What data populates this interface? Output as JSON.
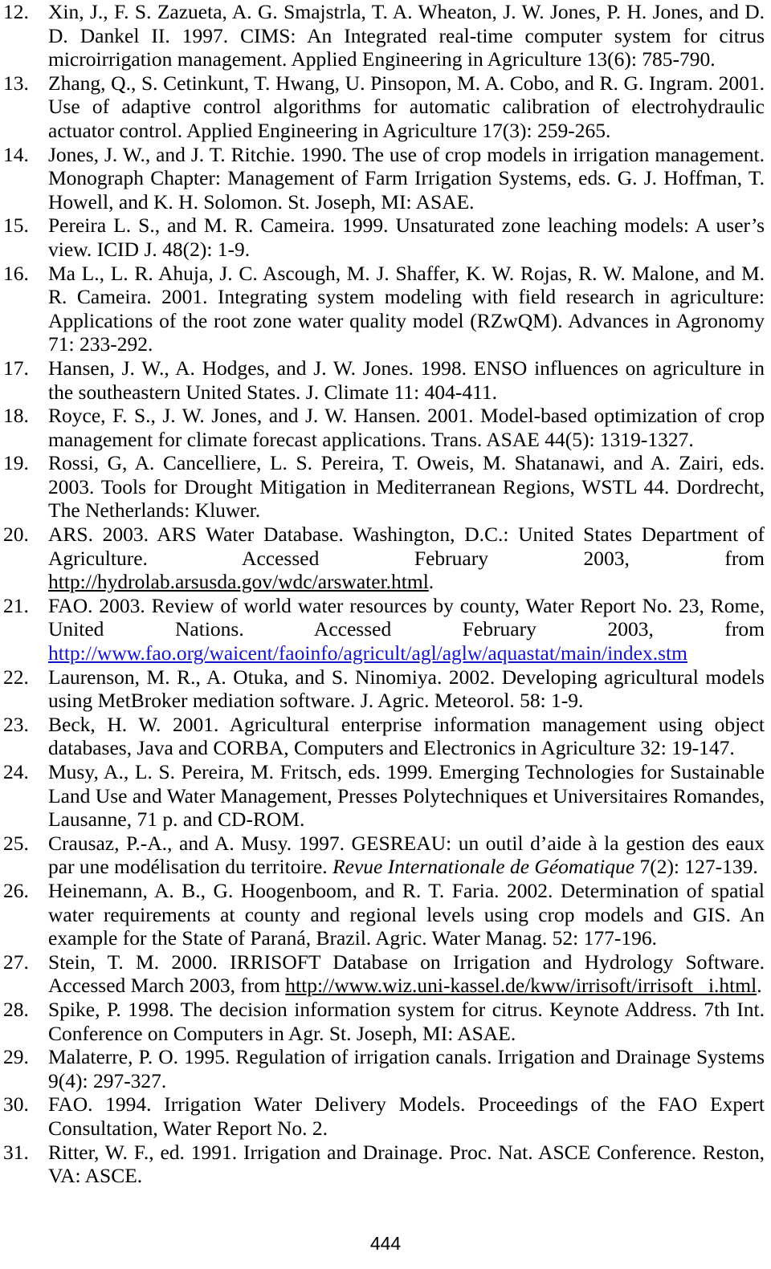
{
  "document": {
    "type": "references-page",
    "page_number": "444",
    "link_color": "#1414c8",
    "text_color": "#000000",
    "background_color": "#ffffff"
  },
  "references": [
    {
      "number": "12.",
      "text": "Xin, J., F. S. Zazueta, A. G. Smajstrla, T. A. Wheaton, J. W. Jones, P. H. Jones, and D. D. Dankel II. 1997. CIMS: An Integrated real-time computer system for citrus microirrigation management. Applied Engineering in Agriculture 13(6): 785-790."
    },
    {
      "number": "13.",
      "text": "Zhang, Q., S. Cetinkunt, T. Hwang, U. Pinsopon, M. A. Cobo, and R. G. Ingram. 2001. Use of adaptive control algorithms for automatic calibration of electrohydraulic actuator control. Applied Engineering in Agriculture 17(3): 259-265."
    },
    {
      "number": "14.",
      "text": "Jones, J. W., and J. T. Ritchie. 1990. The use of crop models in irrigation management. Monograph Chapter: Management of Farm Irrigation Systems, eds. G. J. Hoffman, T. Howell, and K. H. Solomon. St. Joseph, MI: ASAE."
    },
    {
      "number": "15.",
      "text": "Pereira L. S., and M. R. Cameira. 1999. Unsaturated zone leaching models: A user’s view. ICID J. 48(2): 1-9."
    },
    {
      "number": "16.",
      "text": "Ma L., L. R. Ahuja, J. C. Ascough, M. J. Shaffer, K. W. Rojas, R. W. Malone, and M. R. Cameira. 2001. Integrating system modeling with field research in agriculture: Applications of the root zone water quality model (RZwQM). Advances in Agronomy 71: 233-292."
    },
    {
      "number": "17.",
      "text": "Hansen, J. W., A. Hodges, and J. W. Jones. 1998. ENSO influences on agriculture in the southeastern United States. J. Climate 11: 404-411."
    },
    {
      "number": "18.",
      "text": "Royce, F. S., J. W. Jones, and J. W. Hansen. 2001. Model-based optimization of crop management for climate forecast applications. Trans. ASAE 44(5): 1319-1327."
    },
    {
      "number": "19.",
      "text": "Rossi, G, A. Cancelliere, L. S. Pereira, T. Oweis, M. Shatanawi, and A. Zairi, eds. 2003. Tools for Drought Mitigation in Mediterranean Regions, WSTL 44. Dordrecht, The Netherlands: Kluwer."
    },
    {
      "number": "20.",
      "text_before_link": "ARS. 2003. ARS Water Database. Washington, D.C.: United States Department of Agriculture. Accessed February 2003, from ",
      "link_text": "http://hydrolab.arsusda.gov/wdc/arswater.html",
      "link_style": "black-underline",
      "text_after_link": "."
    },
    {
      "number": "21.",
      "text_before_link": "FAO. 2003. Review of world water resources by county, Water Report No. 23, Rome, United Nations. Accessed February 2003, from ",
      "link_text": "http://www.fao.org/waicent/faoinfo/agricult/agl/aglw/aquastat/main/index.stm",
      "link_style": "blue-underline",
      "text_after_link": ""
    },
    {
      "number": "22.",
      "text": "Laurenson, M. R., A. Otuka, and S. Ninomiya. 2002. Developing agricultural models using MetBroker mediation software. J. Agric. Meteorol. 58: 1-9."
    },
    {
      "number": "23.",
      "text": "Beck, H. W. 2001. Agricultural enterprise information management using object databases, Java and CORBA, Computers and Electronics in Agriculture 32: 19-147."
    },
    {
      "number": "24.",
      "text": "Musy, A., L. S. Pereira, M. Fritsch, eds. 1999. Emerging Technologies for Sustainable Land Use and Water Management, Presses Polytechniques et Universitaires Romandes, Lausanne, 71 p. and CD-ROM."
    },
    {
      "number": "25.",
      "text_before_italic": "Crausaz, P.-A., and A. Musy. 1997. GESREAU: un outil d’aide à la gestion des eaux par une modélisation du territoire. ",
      "italic_text": "Revue Internationale de Géomatique",
      "text_after_italic": " 7(2): 127-139."
    },
    {
      "number": "26.",
      "text": "Heinemann, A. B., G. Hoogenboom, and R. T. Faria. 2002. Determination of spatial water requirements at county and regional levels using crop models and GIS. An example for the State of Paraná, Brazil. Agric. Water Manag. 52: 177-196."
    },
    {
      "number": "27.",
      "text_before_link": "Stein, T. M. 2000. IRRISOFT Database on Irrigation and Hydrology Software. Accessed March 2003, from ",
      "link_text": "http://www.wiz.uni-kassel.de/kww/irrisoft/irrisoft _i.html",
      "link_style": "black-underline",
      "text_after_link": "."
    },
    {
      "number": "28.",
      "text": "Spike, P. 1998. The decision information system for citrus. Keynote Address. 7th Int. Conference on Computers in Agr. St. Joseph, MI: ASAE."
    },
    {
      "number": "29.",
      "text": "Malaterre, P. O. 1995. Regulation of irrigation canals. Irrigation and Drainage Systems 9(4): 297-327."
    },
    {
      "number": "30.",
      "text": "FAO. 1994. Irrigation Water Delivery Models. Proceedings of the FAO Expert Consultation, Water Report No. 2."
    },
    {
      "number": "31.",
      "text": "Ritter, W. F., ed. 1991. Irrigation and Drainage. Proc. Nat. ASCE Conference. Reston, VA: ASCE."
    }
  ]
}
